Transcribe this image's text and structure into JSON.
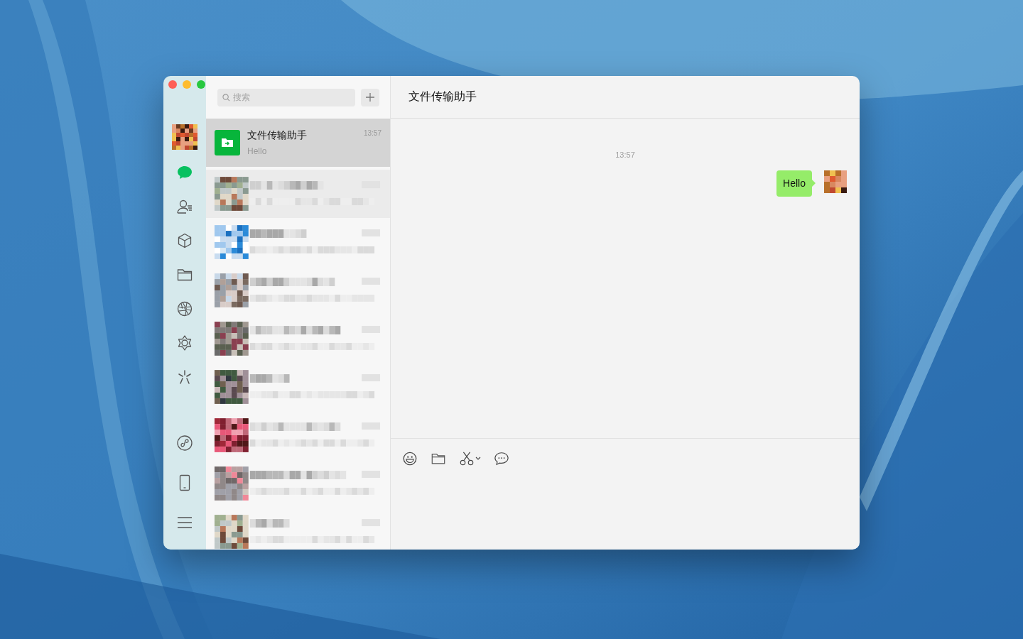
{
  "window": {
    "controls": [
      {
        "color": "#fe5f57"
      },
      {
        "color": "#febc2e"
      },
      {
        "color": "#28c840"
      }
    ]
  },
  "sidebar": {
    "nav": [
      {
        "kind": "chats",
        "selected": true
      },
      {
        "kind": "contacts",
        "selected": false
      },
      {
        "kind": "box",
        "selected": false
      },
      {
        "kind": "folder",
        "selected": false
      },
      {
        "kind": "moments",
        "selected": false
      },
      {
        "kind": "channels",
        "selected": false
      },
      {
        "kind": "search",
        "selected": false
      }
    ],
    "bottom": [
      {
        "kind": "miniprogram"
      },
      {
        "kind": "phone"
      },
      {
        "kind": "menu"
      }
    ]
  },
  "search": {
    "placeholder": "搜索"
  },
  "chats": [
    {
      "kind": "contact",
      "name": "文件传输助手",
      "preview": "Hello",
      "time": "13:57",
      "selected": true,
      "hovered": false
    },
    {
      "kind": "blurred",
      "selected": false,
      "hovered": true
    },
    {
      "kind": "blurred",
      "selected": false,
      "hovered": false
    },
    {
      "kind": "blurred",
      "selected": false,
      "hovered": false
    },
    {
      "kind": "blurred",
      "selected": false,
      "hovered": false
    },
    {
      "kind": "blurred",
      "selected": false,
      "hovered": false
    },
    {
      "kind": "blurred",
      "selected": false,
      "hovered": false
    },
    {
      "kind": "blurred",
      "selected": false,
      "hovered": false
    },
    {
      "kind": "blurred",
      "selected": false,
      "hovered": false
    }
  ],
  "conversation": {
    "title": "文件传输助手",
    "messages": [
      {
        "kind": "timestamp",
        "text": "13:57"
      },
      {
        "kind": "outgoing",
        "text": "Hello"
      }
    ],
    "toolbar": [
      {
        "kind": "emoji"
      },
      {
        "kind": "folder"
      },
      {
        "kind": "screenshot"
      },
      {
        "kind": "bubble"
      }
    ]
  }
}
